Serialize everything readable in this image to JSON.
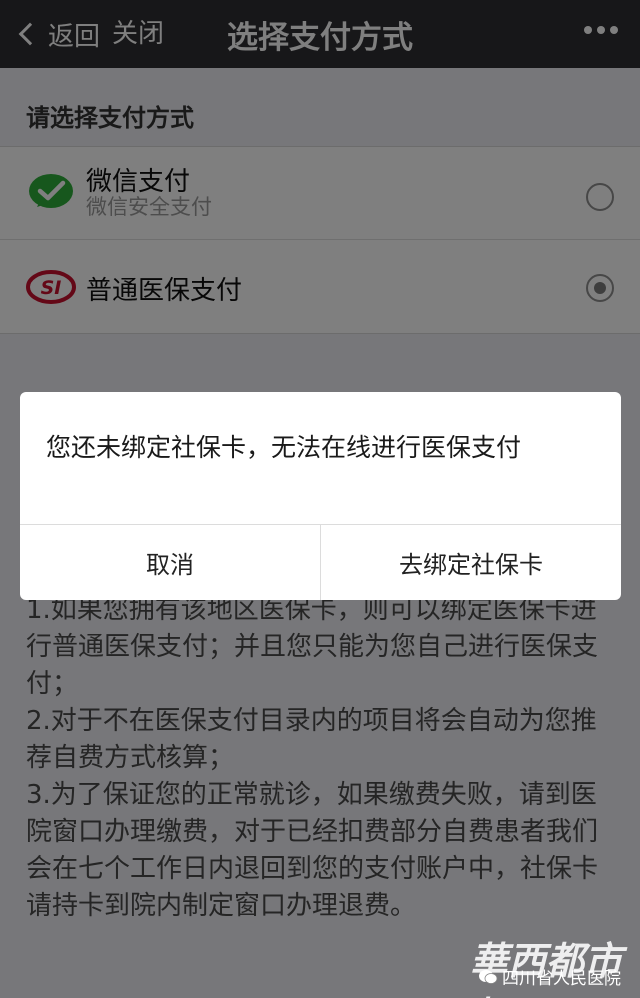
{
  "navbar": {
    "back_label": "返回",
    "close_label": "关闭",
    "title": "选择支付方式"
  },
  "section_title": "请选择支付方式",
  "methods": [
    {
      "name": "微信支付",
      "subtitle": "微信安全支付",
      "icon": "wechat-pay-icon",
      "selected": false
    },
    {
      "name": "普通医保支付",
      "icon": "social-insurance-icon",
      "selected": true
    }
  ],
  "notes": [
    "1.如果您拥有该地区医保卡，则可以绑定医保卡进行普通医保支付；并且您只能为您自己进行医保支付；",
    "2.对于不在医保支付目录内的项目将会自动为您推荐自费方式核算；",
    "3.为了保证您的正常就诊，如果缴费失败，请到医院窗口办理缴费，对于已经扣费部分自费患者我们会在七个工作日内退回到您的支付账户中，社保卡请持卡到院内制定窗口办理退费。"
  ],
  "dialog": {
    "message": "您还未绑定社保卡，无法在线进行医保支付",
    "cancel_label": "取消",
    "confirm_label": "去绑定社保卡"
  },
  "watermark": {
    "brand": "華西都市報",
    "source": "四川省人民医院"
  },
  "colors": {
    "navbar": "#2e2e32",
    "wechat_green": "#2fae3a",
    "si_red": "#c8102e",
    "background": "#efeff4"
  }
}
